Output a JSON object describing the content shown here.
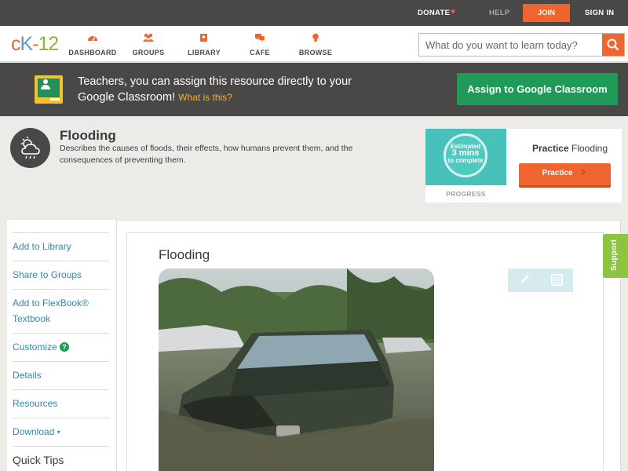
{
  "topbar": {
    "donate_label": "DONATE",
    "help_label": "HELP",
    "join_label": "JOIN",
    "signin_label": "SIGN IN"
  },
  "nav": {
    "logo_c": "c",
    "logo_k": "K",
    "logo_dash": "-",
    "logo_n": "12",
    "items": [
      {
        "label": "DASHBOARD",
        "icon": "dashboard-gauge-icon"
      },
      {
        "label": "GROUPS",
        "icon": "groups-people-icon"
      },
      {
        "label": "LIBRARY",
        "icon": "library-book-icon"
      },
      {
        "label": "CAFE",
        "icon": "cafe-chat-icon"
      },
      {
        "label": "BROWSE",
        "icon": "browse-lightbulb-icon"
      }
    ],
    "search_placeholder": "What do you want to learn today?"
  },
  "banner": {
    "text": "Teachers, you can assign this resource directly to your Google Classroom!",
    "what_link": "What is this?",
    "assign_label": "Assign to Google Classroom"
  },
  "concept": {
    "title": "Flooding",
    "description": "Describes the causes of floods, their effects, how humans prevent them, and the consequences of preventing them."
  },
  "practice": {
    "estimate_line1": "Estimated",
    "estimate_line2": "3 mins",
    "estimate_line3": "to complete",
    "progress_label": "PROGRESS",
    "title_bold": "Practice",
    "title_rest": "Flooding",
    "button_label": "Practice"
  },
  "sidebar": {
    "items": [
      {
        "label": "Add to Library"
      },
      {
        "label": "Share to Groups"
      },
      {
        "label": "Add to FlexBook® Textbook"
      },
      {
        "label": "Customize"
      },
      {
        "label": "Details"
      },
      {
        "label": "Resources"
      },
      {
        "label": "Download"
      },
      {
        "label": "Quick Tips"
      }
    ],
    "help_glyph": "?",
    "download_caret": "▾"
  },
  "content": {
    "section_title": "Flooding"
  },
  "support": {
    "label": "Support"
  },
  "colors": {
    "accent_orange": "#f0642e",
    "classroom_green": "#1f9a58",
    "link_blue": "#2f8ab0",
    "support_green": "#8cc43f",
    "progress_teal": "#47c1b9"
  }
}
